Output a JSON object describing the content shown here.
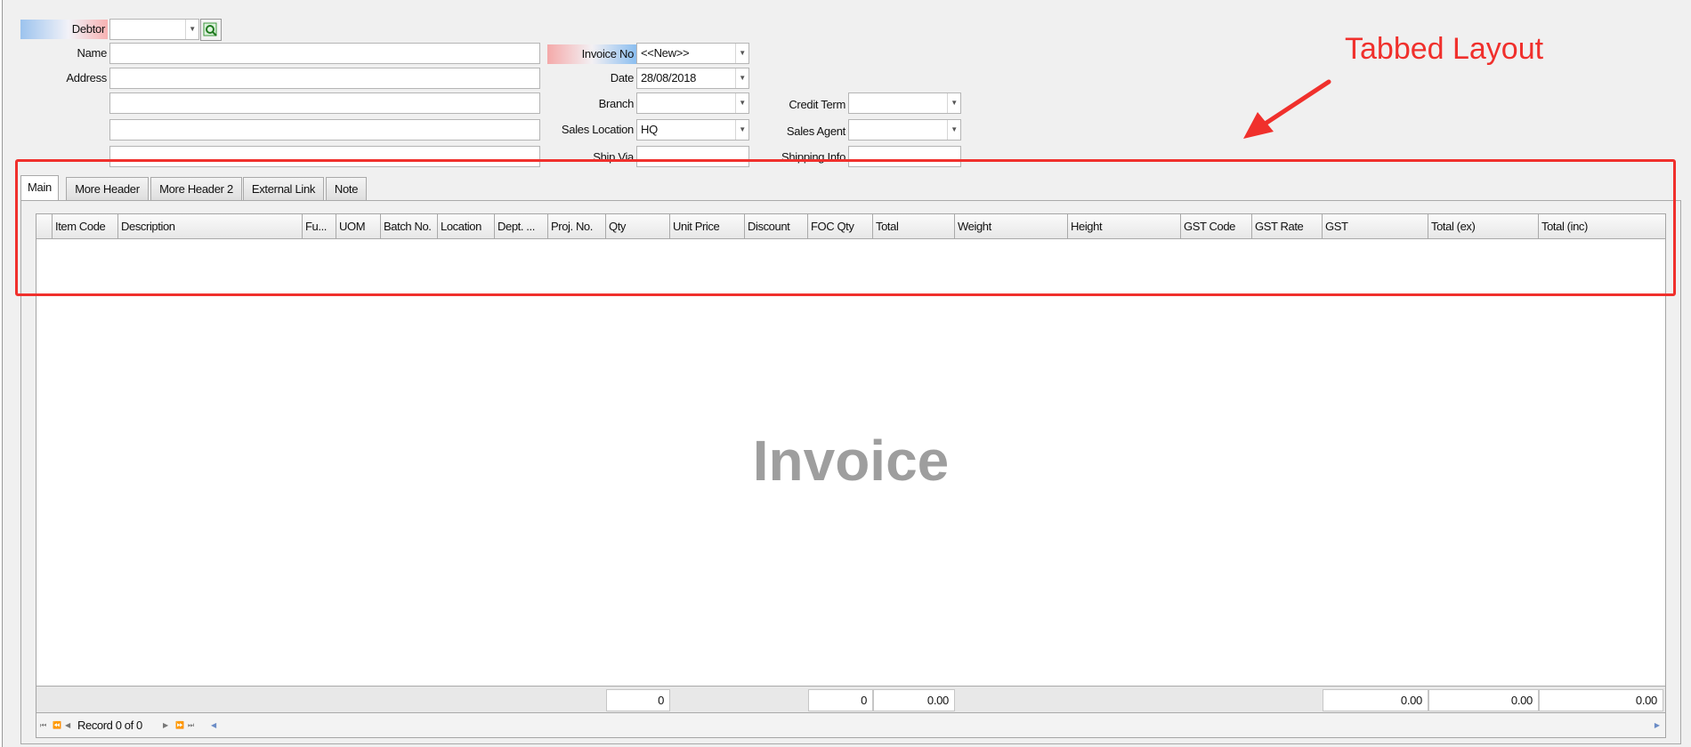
{
  "header": {
    "debtor_label": "Debtor",
    "name_label": "Name",
    "address_label": "Address",
    "invoice_no_label": "Invoice No",
    "invoice_no_value": "<<New>>",
    "date_label": "Date",
    "date_value": "28/08/2018",
    "branch_label": "Branch",
    "sales_location_label": "Sales Location",
    "sales_location_value": "HQ",
    "ship_via_label": "Ship Via",
    "credit_term_label": "Credit Term",
    "sales_agent_label": "Sales Agent",
    "shipping_info_label": "Shipping Info"
  },
  "tabs": [
    "Main",
    "More Header",
    "More Header 2",
    "External Link",
    "Note"
  ],
  "grid": {
    "columns": [
      "",
      "Item Code",
      "Description",
      "Fu...",
      "UOM",
      "Batch No.",
      "Location",
      "Dept. ...",
      "Proj. No.",
      "Qty",
      "Unit Price",
      "Discount",
      "FOC Qty",
      "Total",
      "Weight",
      "Height",
      "GST Code",
      "GST Rate",
      "GST",
      "Total (ex)",
      "Total (inc)"
    ],
    "watermark": "Invoice",
    "totals": {
      "qty": "0",
      "foc_qty": "0",
      "total": "0.00",
      "gst": "0.00",
      "total_ex": "0.00",
      "total_inc": "0.00"
    },
    "record_text": "Record 0 of 0"
  },
  "annotation": {
    "text": "Tabbed Layout",
    "color": "#f0302c"
  }
}
